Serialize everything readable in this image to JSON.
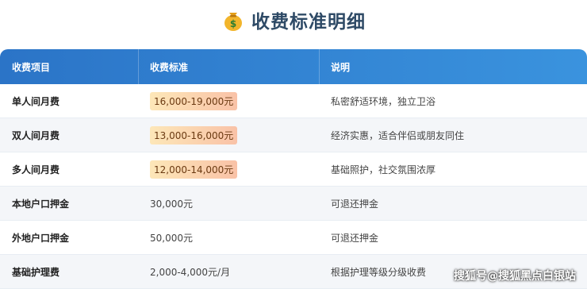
{
  "header": {
    "title": "收费标准明细",
    "icon": "money-bag-icon"
  },
  "table": {
    "columns": [
      "收费项目",
      "收费标准",
      "说明"
    ],
    "rows": [
      {
        "item": "单人间月费",
        "price": "16,000-19,000元",
        "highlight": true,
        "note": "私密舒适环境，独立卫浴"
      },
      {
        "item": "双人间月费",
        "price": "13,000-16,000元",
        "highlight": true,
        "note": "经济实惠，适合伴侣或朋友同住"
      },
      {
        "item": "多人间月费",
        "price": "12,000-14,000元",
        "highlight": true,
        "note": "基础照护，社交氛围浓厚"
      },
      {
        "item": "本地户口押金",
        "price": "30,000元",
        "highlight": false,
        "note": "可退还押金"
      },
      {
        "item": "外地户口押金",
        "price": "50,000元",
        "highlight": false,
        "note": "可退还押金"
      },
      {
        "item": "基础护理费",
        "price": "2,000-4,000元/月",
        "highlight": false,
        "note": "根据护理等级分级收费"
      }
    ]
  },
  "watermark": "搜狐号@搜狐黑点白银站",
  "colors": {
    "header_start": "#2b74c7",
    "header_end": "#3a93de",
    "title": "#2e4a66"
  }
}
